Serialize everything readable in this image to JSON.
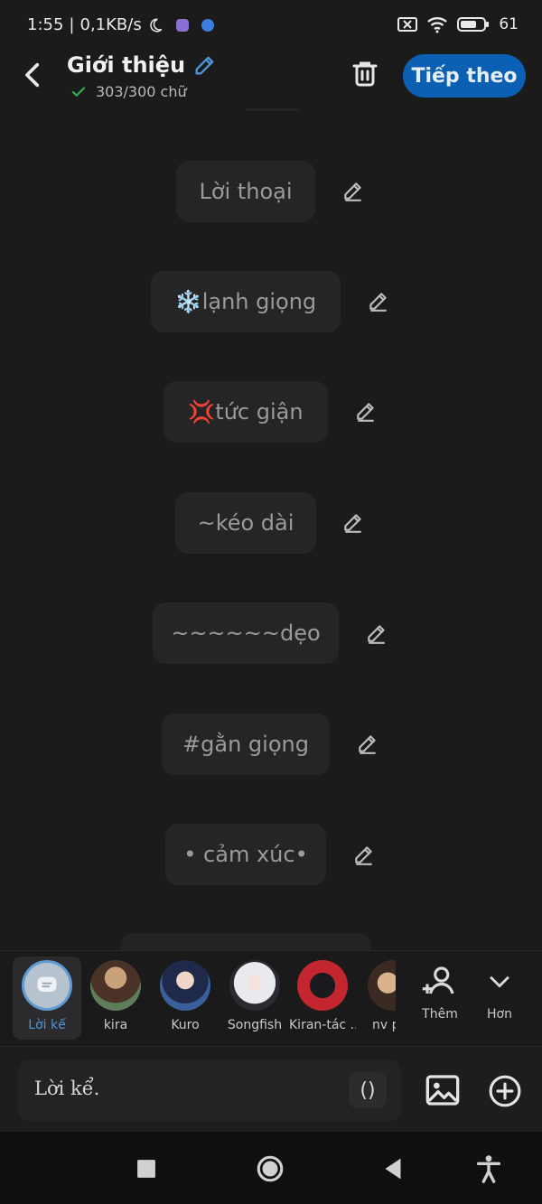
{
  "status": {
    "time": "1:55",
    "sep": "|",
    "speed": "0,1KB/s",
    "battery": "61"
  },
  "header": {
    "title": "Giới thiệu",
    "count": "303/300 chữ",
    "next_label": "Tiếp theo"
  },
  "chips": [
    {
      "label": "Lời thoại"
    },
    {
      "label": "❄️lạnh giọng"
    },
    {
      "label": "💢tức giận"
    },
    {
      "label": "~kéo dài"
    },
    {
      "label": "~~~~~~dẹo"
    },
    {
      "label": "#gằn giọng"
    },
    {
      "label": "• cảm xúc•"
    }
  ],
  "characters": [
    {
      "name": "Lời kể"
    },
    {
      "name": "kira"
    },
    {
      "name": "Kuro"
    },
    {
      "name": "Songfish"
    },
    {
      "name": "Kiran-tác ..."
    },
    {
      "name": "nv p"
    }
  ],
  "actions": {
    "more_label": "Thêm",
    "expand_label": "Hơn"
  },
  "input": {
    "value": "Lời kể.",
    "paren": "()"
  },
  "colors": {
    "accent": "#0b60b3",
    "active_text": "#4e95d9",
    "check": "#2fae4a"
  }
}
